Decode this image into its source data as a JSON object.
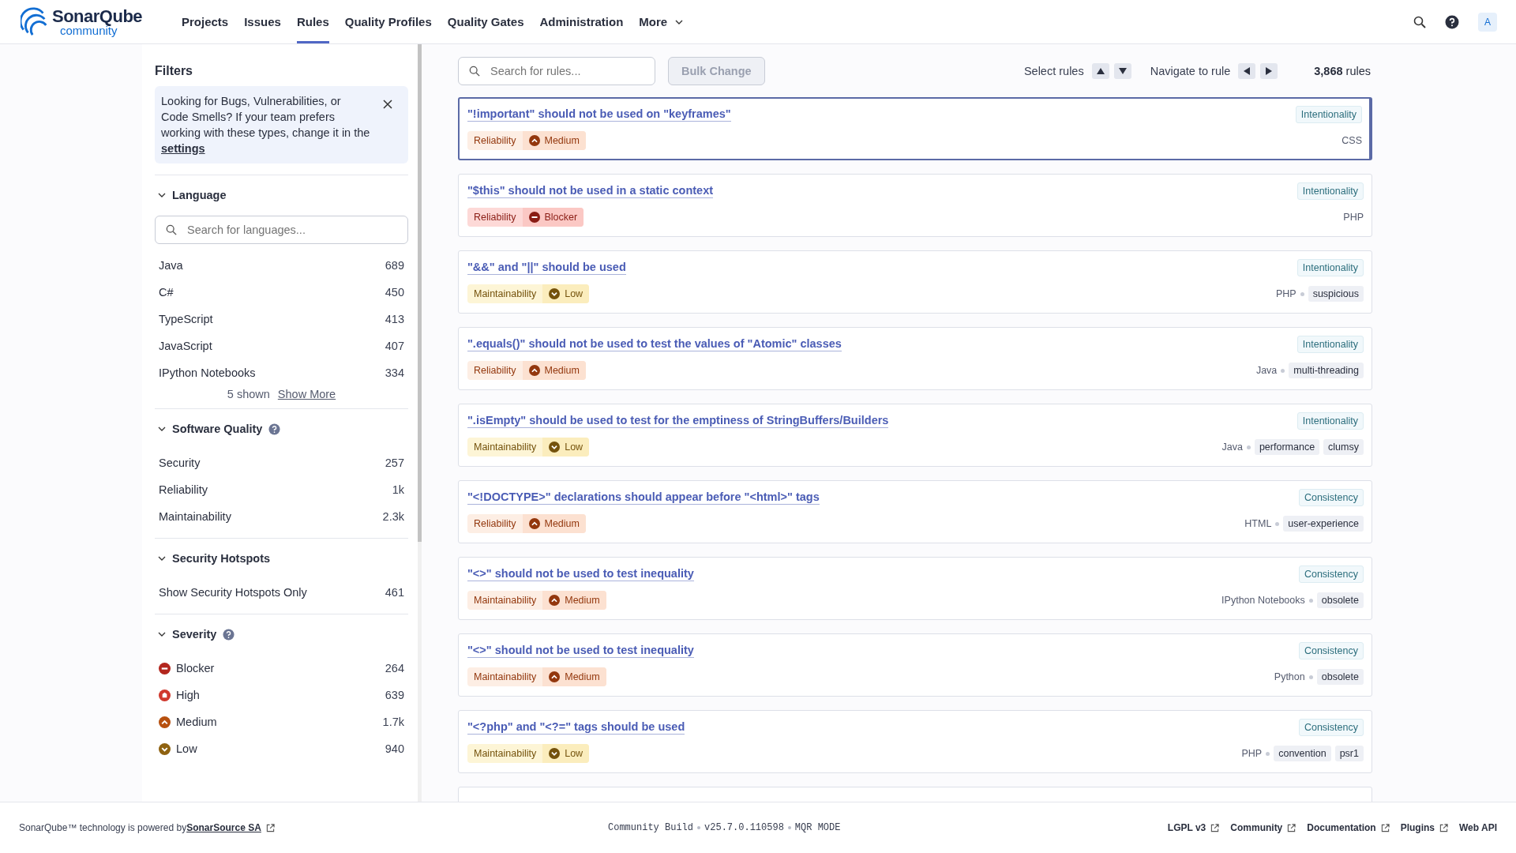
{
  "logo": {
    "name": "SonarQube",
    "edition": "community"
  },
  "nav": [
    {
      "label": "Projects",
      "selected": false
    },
    {
      "label": "Issues",
      "selected": false
    },
    {
      "label": "Rules",
      "selected": true
    },
    {
      "label": "Quality Profiles",
      "selected": false
    },
    {
      "label": "Quality Gates",
      "selected": false
    },
    {
      "label": "Administration",
      "selected": false
    },
    {
      "label": "More",
      "selected": false,
      "dropdown": true
    }
  ],
  "avatar": "A",
  "filters": {
    "title": "Filters",
    "notice": {
      "text": "Looking for Bugs, Vulnerabilities, or Code Smells? If your team prefers working with these types, change it in the ",
      "link": "settings"
    },
    "sections": [
      {
        "title": "Language",
        "expanded": true,
        "help": false,
        "search_placeholder": "Search for languages...",
        "items": [
          {
            "label": "Java",
            "count": "689"
          },
          {
            "label": "C#",
            "count": "450"
          },
          {
            "label": "TypeScript",
            "count": "413"
          },
          {
            "label": "JavaScript",
            "count": "407"
          },
          {
            "label": "IPython Notebooks",
            "count": "334"
          }
        ],
        "shown": "5 shown",
        "show_more": "Show More"
      },
      {
        "title": "Software Quality",
        "expanded": true,
        "help": true,
        "items": [
          {
            "label": "Security",
            "count": "257"
          },
          {
            "label": "Reliability",
            "count": "1k"
          },
          {
            "label": "Maintainability",
            "count": "2.3k"
          }
        ]
      },
      {
        "title": "Security Hotspots",
        "expanded": true,
        "help": false,
        "items": [
          {
            "label": "Show Security Hotspots Only",
            "count": "461"
          }
        ]
      },
      {
        "title": "Severity",
        "expanded": true,
        "help": true,
        "items": [
          {
            "label": "Blocker",
            "count": "264",
            "kind": "blocker"
          },
          {
            "label": "High",
            "count": "639",
            "kind": "high"
          },
          {
            "label": "Medium",
            "count": "1.7k",
            "kind": "medium"
          },
          {
            "label": "Low",
            "count": "940",
            "kind": "low"
          }
        ]
      }
    ]
  },
  "toolbar": {
    "search_placeholder": "Search for rules...",
    "bulk_change": {
      "label": "Bulk Change",
      "disabled": true
    },
    "select_label": "Select rules",
    "navigate_label": "Navigate to rule",
    "count": "**3,868** rules"
  },
  "rules": [
    {
      "title": "\"!important\" should not be used on \"keyframes\"",
      "attribute": "Intentionality",
      "quality": "Reliability",
      "severity": {
        "kind": "medium",
        "label": "Medium"
      },
      "language": "CSS",
      "selected": true
    },
    {
      "title": "\"$this\" should not be used in a static context",
      "attribute": "Intentionality",
      "quality": "Reliability",
      "severity": {
        "kind": "blocker",
        "label": "Blocker"
      },
      "language": "PHP",
      "selected": false
    },
    {
      "title": "\"&&\" and \"||\" should be used",
      "attribute": "Intentionality",
      "quality": "Maintainability",
      "severity": {
        "kind": "low",
        "label": "Low"
      },
      "language": "PHP",
      "tags": [
        "suspicious"
      ],
      "selected": false
    },
    {
      "title": "\".equals()\" should not be used to test the values of \"Atomic\" classes",
      "attribute": "Intentionality",
      "quality": "Reliability",
      "severity": {
        "kind": "medium",
        "label": "Medium"
      },
      "language": "Java",
      "tags": [
        "multi-threading"
      ],
      "selected": false
    },
    {
      "title": "\".isEmpty\" should be used to test for the emptiness of StringBuffers/Builders",
      "attribute": "Intentionality",
      "quality": "Maintainability",
      "severity": {
        "kind": "low",
        "label": "Low"
      },
      "language": "Java",
      "tags": [
        "performance",
        "clumsy"
      ],
      "selected": false
    },
    {
      "title": "\"<!DOCTYPE>\" declarations should appear before \"<html>\" tags",
      "attribute": "Consistency",
      "quality": "Reliability",
      "severity": {
        "kind": "medium",
        "label": "Medium"
      },
      "language": "HTML",
      "tags": [
        "user-experience"
      ],
      "selected": false
    },
    {
      "title": "\"<>\" should not be used to test inequality",
      "attribute": "Consistency",
      "quality": "Maintainability",
      "severity": {
        "kind": "medium",
        "label": "Medium"
      },
      "language": "IPython Notebooks",
      "tags": [
        "obsolete"
      ],
      "selected": false
    },
    {
      "title": "\"<>\" should not be used to test inequality",
      "attribute": "Consistency",
      "quality": "Maintainability",
      "severity": {
        "kind": "medium",
        "label": "Medium"
      },
      "language": "Python",
      "tags": [
        "obsolete"
      ],
      "selected": false
    },
    {
      "title": "\"<?php\" and \"<?=\" tags should be used",
      "attribute": "Consistency",
      "quality": "Maintainability",
      "severity": {
        "kind": "low",
        "label": "Low"
      },
      "language": "PHP",
      "tags": [
        "convention",
        "psr1"
      ],
      "selected": false
    }
  ],
  "footer": {
    "powered": "SonarQube™ technology is powered by ",
    "powered_link": "SonarSource SA",
    "build": [
      "Community Build",
      "v25.7.0.110598",
      "MQR MODE"
    ],
    "links": [
      {
        "label": "LGPL v3",
        "external": true
      },
      {
        "label": "Community",
        "external": true
      },
      {
        "label": "Documentation",
        "external": true
      },
      {
        "label": "Plugins",
        "external": true
      },
      {
        "label": "Web API",
        "external": false
      }
    ]
  }
}
